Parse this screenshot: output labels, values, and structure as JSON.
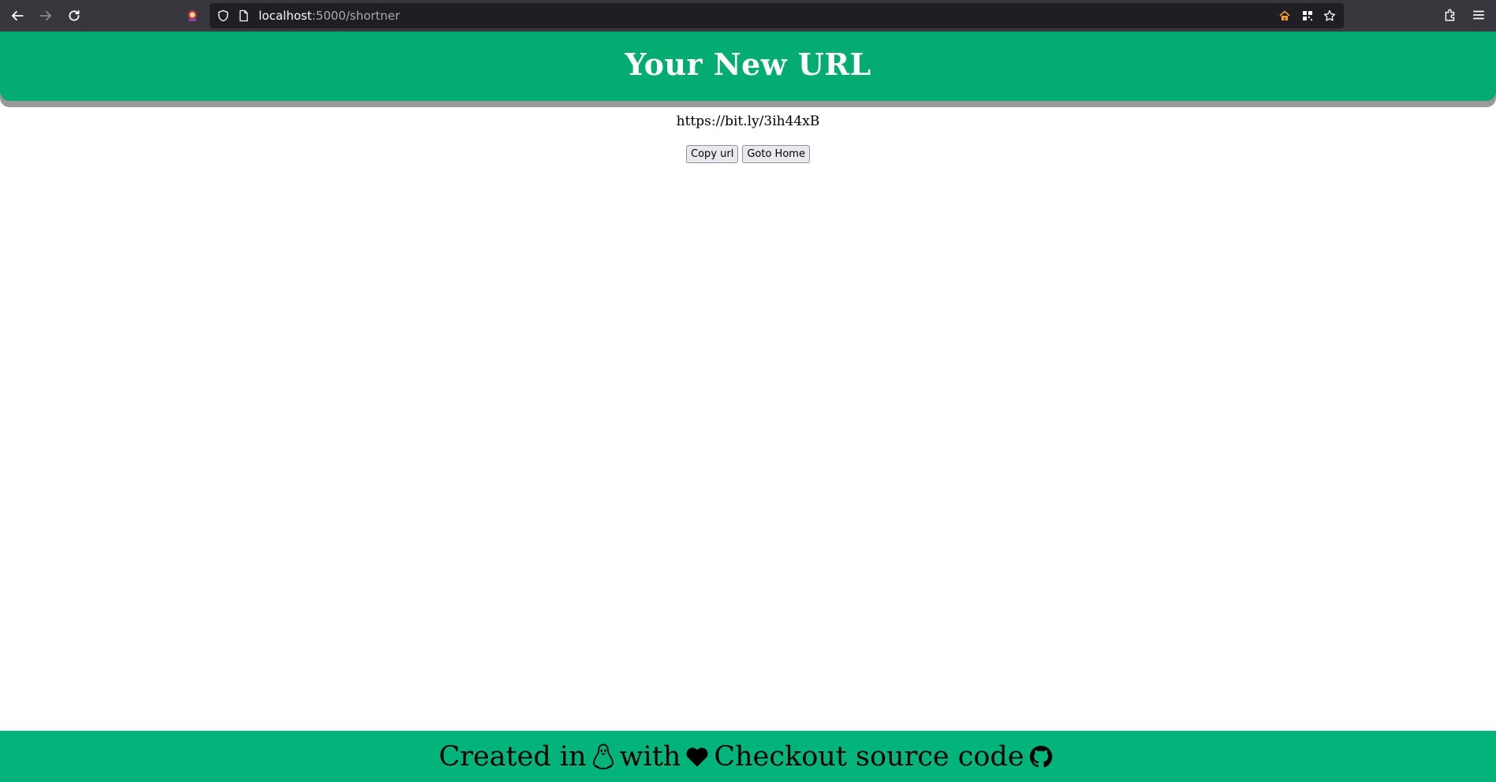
{
  "browser": {
    "address_host": "localhost",
    "address_path": ":5000/shortner",
    "icons": [
      "back-icon",
      "forward-icon",
      "reload-icon",
      "extension-icon",
      "shield-icon",
      "page-icon",
      "home-icon",
      "qr-icon",
      "star-icon",
      "extensions-icon",
      "menu-icon"
    ]
  },
  "header": {
    "title": "Your New URL",
    "background": "#04ac72"
  },
  "main": {
    "short_url": "https://bit.ly/3ih44xB",
    "copy_label": "Copy url",
    "home_label": "Goto Home"
  },
  "footer": {
    "created_in": "Created in",
    "with": "with",
    "checkout": "Checkout source code",
    "icons": [
      "linux-icon",
      "heart-icon",
      "github-icon"
    ],
    "background": "#02b47b"
  }
}
